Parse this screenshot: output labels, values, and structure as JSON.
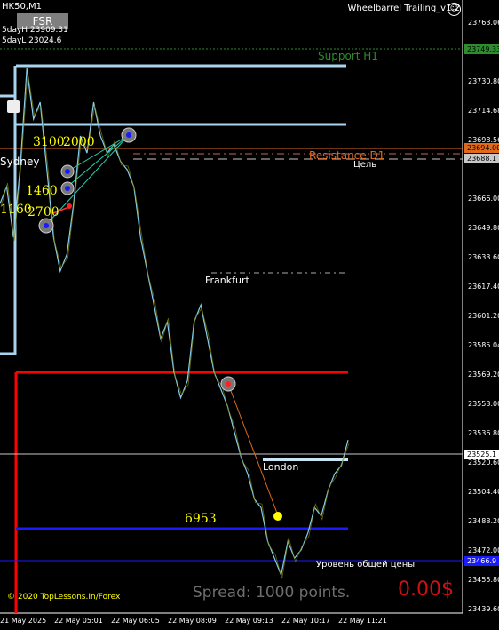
{
  "header": {
    "symbol": "HK50,M1",
    "day_high": "5dayH 23909.31",
    "day_low": "5dayL 23024.6",
    "fsr_button": "FSR",
    "ea_name": "Wheelbarrel Trailing_v1.2",
    "ea_face": "☺"
  },
  "levels": {
    "support": "Support H1",
    "resistance": "Resistance D1",
    "target": "Цель",
    "total_level": "Уровень общей цены"
  },
  "sessions": {
    "sydney": "Sydney",
    "frankfurt": "Frankfurt",
    "london": "London"
  },
  "trade_numbers": {
    "n3100": "3100",
    "n2000": "2000",
    "n1460": "1460",
    "n1160": "1160",
    "n2700": "2700",
    "n6953": "6953"
  },
  "footer": {
    "copyright": "© 2020 TopLessons.In/Forex",
    "spread": "Spread: 1000 points.",
    "profit": "0.00$"
  },
  "price_axis": [
    "23763.06",
    "23730.80",
    "23714.68",
    "23698.56",
    "23666.00",
    "23649.80",
    "23633.60",
    "23617.40",
    "23601.20",
    "23585.04",
    "23569.20",
    "23553.00",
    "23536.80",
    "23520.60",
    "23504.40",
    "23488.20",
    "23472.00",
    "23455.80",
    "23439.60"
  ],
  "price_boxes": [
    {
      "label": "23749.33",
      "color": "#2d8c2d"
    },
    {
      "label": "23694.00",
      "color": "#e06a1a"
    },
    {
      "label": "23688.1",
      "color": "#c8c8c8"
    },
    {
      "label": "23525.1",
      "color": "#ffffff"
    },
    {
      "label": "23466.9",
      "color": "#1a1aff"
    }
  ],
  "time_axis": [
    "21 May 2025",
    "22 May 05:01",
    "22 May 06:05",
    "22 May 08:09",
    "22 May 09:13",
    "22 May 10:17",
    "22 May 11:21"
  ],
  "colors": {
    "background": "#000000",
    "price_line": "#87ceeb",
    "candle_body": "#808000",
    "support": "#2d8c2d",
    "resistance": "#e06a1a",
    "red_box": "#ff0000",
    "blue_line": "#1a1aff"
  },
  "chart_data": {
    "type": "line",
    "title": "HK50,M1",
    "ylim": [
      23439.6,
      23790
    ],
    "series": [
      {
        "values": [
          23680,
          23690,
          23660,
          23700,
          23760,
          23730,
          23740,
          23700,
          23660,
          23640,
          23650,
          23680,
          23720,
          23710,
          23740,
          23720,
          23710,
          23715,
          23705,
          23700,
          23690,
          23660,
          23640,
          23620,
          23600,
          23610,
          23580,
          23565,
          23575,
          23610,
          23620,
          23600,
          23580,
          23570,
          23560,
          23545,
          23530,
          23520,
          23505,
          23500,
          23480,
          23470,
          23460,
          23480,
          23470,
          23475,
          23485,
          23500,
          23495,
          23510,
          23520,
          23525,
          23540
        ]
      }
    ]
  }
}
